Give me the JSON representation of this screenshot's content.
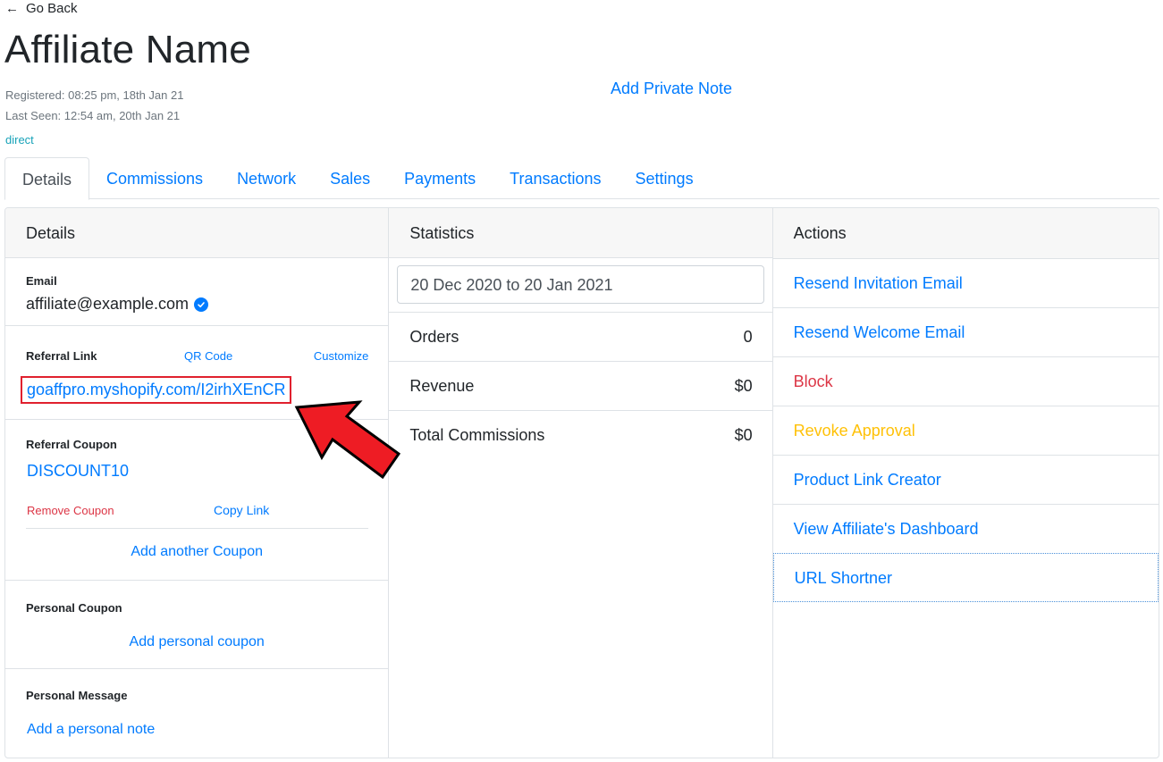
{
  "header": {
    "go_back": "Go Back",
    "title": "Affiliate Name",
    "registered": "Registered: 08:25 pm, 18th Jan 21",
    "last_seen": "Last Seen: 12:54 am, 20th Jan 21",
    "source": "direct",
    "private_note": "Add Private Note"
  },
  "tabs": [
    {
      "label": "Details",
      "active": true
    },
    {
      "label": "Commissions"
    },
    {
      "label": "Network"
    },
    {
      "label": "Sales"
    },
    {
      "label": "Payments"
    },
    {
      "label": "Transactions"
    },
    {
      "label": "Settings"
    }
  ],
  "details": {
    "heading": "Details",
    "email_label": "Email",
    "email_value": "affiliate@example.com",
    "referral_label": "Referral Link",
    "qr_code": "QR Code",
    "customize": "Customize",
    "referral_link": "goaffpro.myshopify.com/I2irhXEnCR",
    "coupon_label": "Referral Coupon",
    "coupon_code": "DISCOUNT10",
    "remove_coupon": "Remove Coupon",
    "copy_link": "Copy Link",
    "add_another_coupon": "Add another Coupon",
    "personal_coupon_label": "Personal Coupon",
    "add_personal_coupon": "Add personal coupon",
    "personal_message_label": "Personal Message",
    "add_personal_note": "Add a personal note"
  },
  "statistics": {
    "heading": "Statistics",
    "date_range": "20 Dec 2020 to 20 Jan 2021",
    "rows": [
      {
        "label": "Orders",
        "value": "0"
      },
      {
        "label": "Revenue",
        "value": "$0"
      },
      {
        "label": "Total Commissions",
        "value": "$0"
      }
    ]
  },
  "actions": {
    "heading": "Actions",
    "items": [
      {
        "label": "Resend Invitation Email",
        "color": "#007bff"
      },
      {
        "label": "Resend Welcome Email",
        "color": "#007bff"
      },
      {
        "label": "Block",
        "color": "#dc3545"
      },
      {
        "label": "Revoke Approval",
        "color": "#ffc107"
      },
      {
        "label": "Product Link Creator",
        "color": "#007bff"
      },
      {
        "label": "View Affiliate's Dashboard",
        "color": "#007bff"
      },
      {
        "label": "URL Shortner",
        "color": "#007bff"
      }
    ]
  },
  "colors": {
    "link": "#007bff",
    "danger": "#dc3545",
    "warning": "#ffc107",
    "annotation": "#e0202e"
  }
}
